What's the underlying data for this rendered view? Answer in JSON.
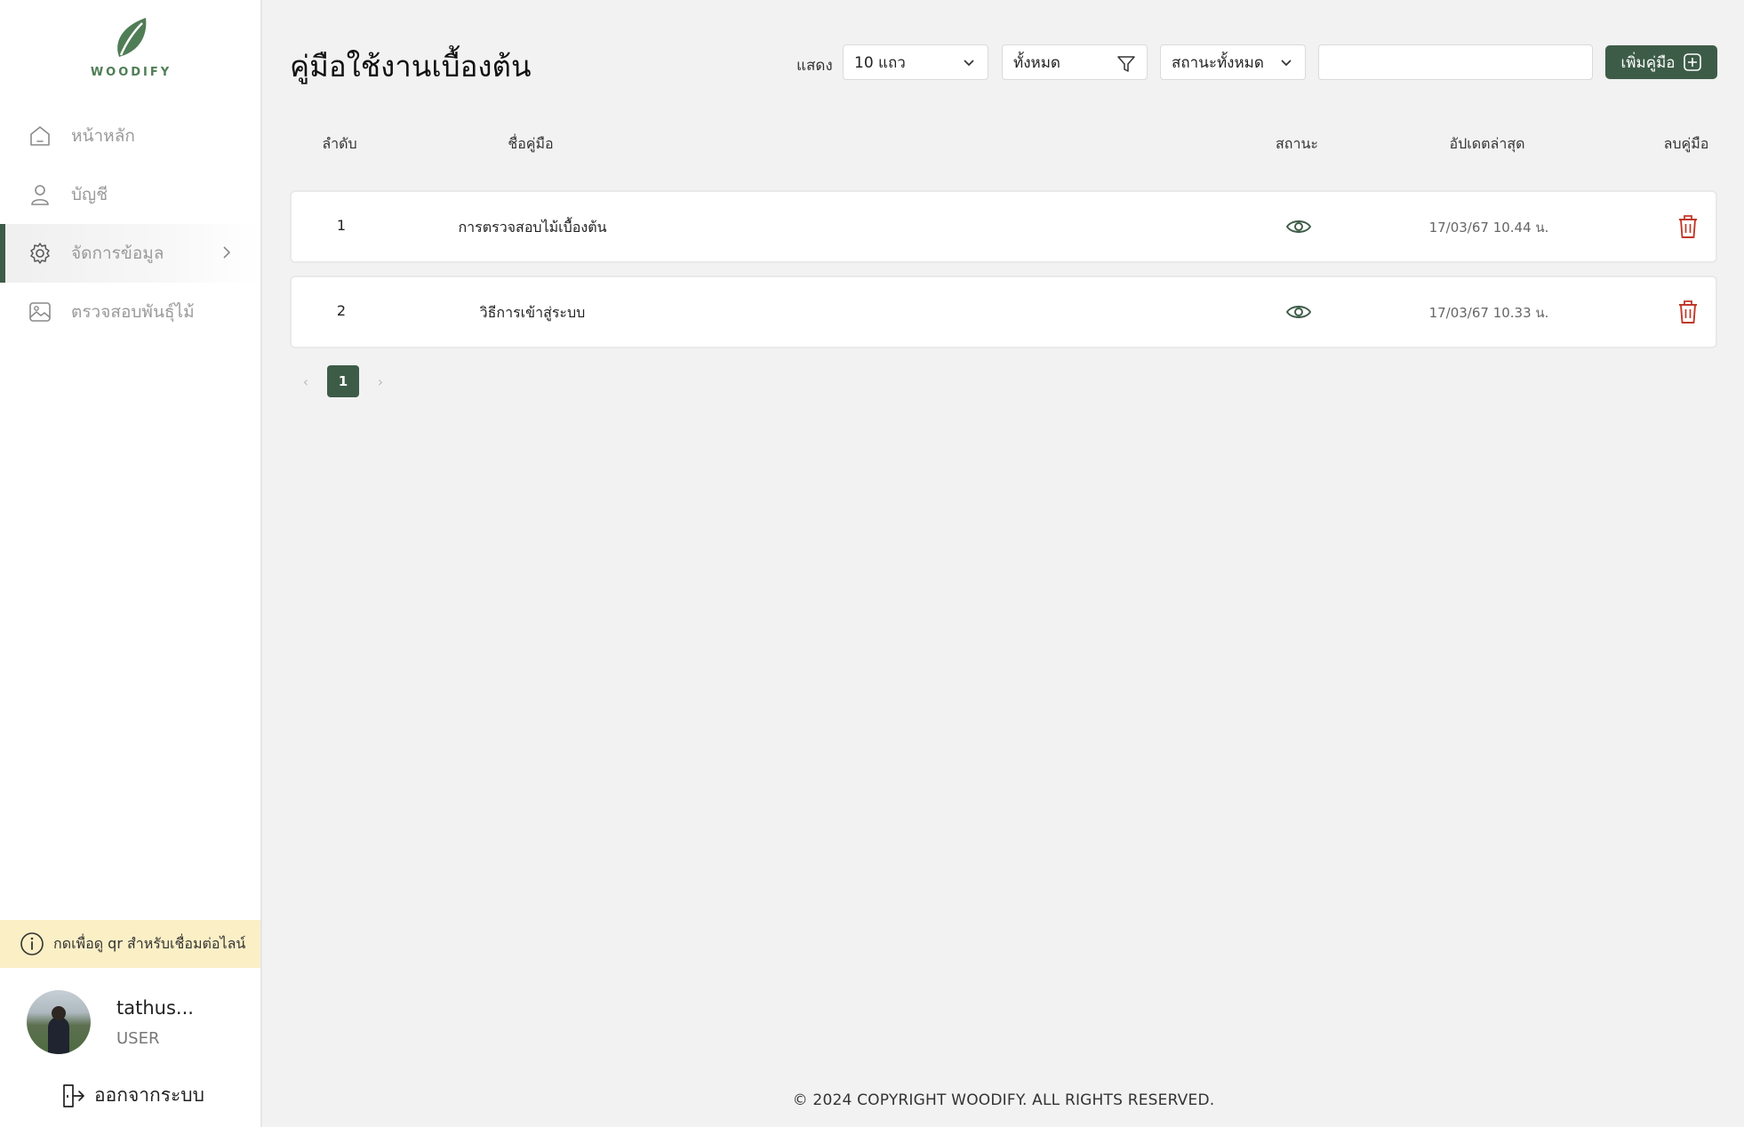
{
  "brand": {
    "logo_text": "WOODIFY",
    "accent_color": "#3d5c48",
    "leaf_color": "#4f7d55",
    "danger_color": "#c0392b"
  },
  "sidebar": {
    "items": [
      {
        "label": "หน้าหลัก",
        "icon": "home-icon",
        "active": false
      },
      {
        "label": "บัญชี",
        "icon": "user-icon",
        "active": false
      },
      {
        "label": "จัดการข้อมูล",
        "icon": "gear-icon",
        "active": true,
        "has_submenu": true
      },
      {
        "label": "ตรวจสอบพันธุ์ไม้",
        "icon": "image-icon",
        "active": false
      }
    ],
    "qr_banner": "กดเพื่อดู qr สำหรับเชื่อมต่อไลน์",
    "user": {
      "name": "tathus...",
      "role": "USER"
    },
    "logout_label": "ออกจากระบบ"
  },
  "main": {
    "title": "คู่มือใช้งานเบื้องต้น",
    "toolbar": {
      "show_label": "แสดง",
      "rows_select": "10 แถว",
      "filter_select": "ทั้งหมด",
      "status_select": "สถานะทั้งหมด",
      "search_value": "",
      "search_placeholder": "",
      "add_button": "เพิ่มคู่มือ"
    },
    "columns": [
      "ลำดับ",
      "ชื่อคู่มือ",
      "สถานะ",
      "อัปเดตล่าสุด",
      "ลบคู่มือ"
    ],
    "rows": [
      {
        "no": "1",
        "name": "การตรวจสอบไม้เบื้องต้น",
        "status_icon": "eye-icon",
        "updated": "17/03/67 10.44 น."
      },
      {
        "no": "2",
        "name": "วิธีการเข้าสู่ระบบ",
        "status_icon": "eye-icon",
        "updated": "17/03/67 10.33 น."
      }
    ],
    "pagination": {
      "current": "1",
      "prev": "‹",
      "next": "›"
    }
  },
  "footer": "© 2024 COPYRIGHT WOODIFY. ALL RIGHTS RESERVED."
}
